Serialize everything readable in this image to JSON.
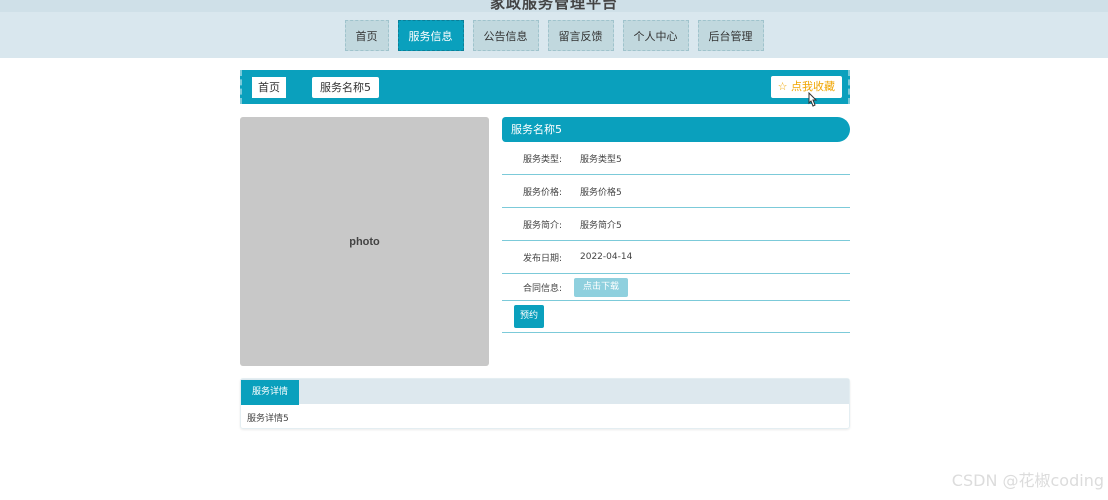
{
  "header": {
    "site_title": "家政服务管理平台"
  },
  "nav": {
    "items": [
      {
        "label": "首页"
      },
      {
        "label": "服务信息"
      },
      {
        "label": "公告信息"
      },
      {
        "label": "留言反馈"
      },
      {
        "label": "个人中心"
      },
      {
        "label": "后台管理"
      }
    ]
  },
  "breadcrumb": {
    "home": "首页",
    "current": "服务名称5"
  },
  "favorite": {
    "icon": "star-icon",
    "label": "☆ 点我收藏",
    "color": "#f0a500"
  },
  "service": {
    "title": "服务名称5",
    "type_label": "服务类型:",
    "type_value": "服务类型5",
    "price_label": "服务价格:",
    "price_value": "服务价格5",
    "intro_label": "服务简介:",
    "intro_value": "服务简介5",
    "date_label": "发布日期:",
    "date_value": "2022-04-14",
    "contract_label": "合同信息:",
    "download_label": "点击下载",
    "book_label": "预约"
  },
  "detail": {
    "tab_label": "服务详情",
    "content": "服务详情5"
  },
  "watermark": "CSDN @花椒coding",
  "colors": {
    "accent": "#0aa0bd",
    "nav_bg": "#c1d8de",
    "header_bg": "#d9e7ee"
  }
}
